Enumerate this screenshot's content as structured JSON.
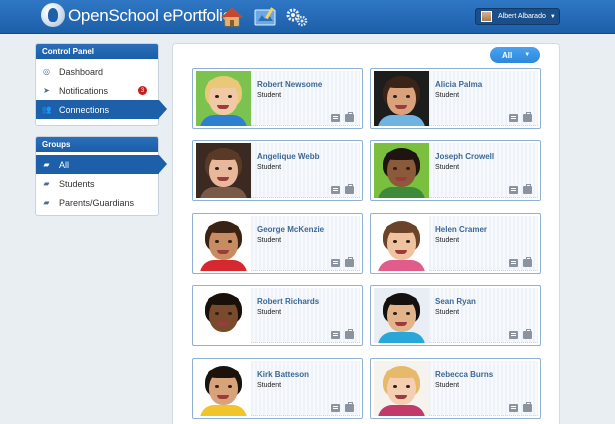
{
  "header": {
    "app_title": "OpenSchool ePortfolio",
    "icons": [
      "home-icon",
      "portfolio-icon",
      "settings-gears-icon"
    ],
    "user_name": "Albert Albarado"
  },
  "control_panel": {
    "title": "Control Panel",
    "items": [
      {
        "label": "Dashboard",
        "icon": "dashboard-icon",
        "active": false
      },
      {
        "label": "Notifications",
        "icon": "cursor-icon",
        "active": false,
        "badge": "3"
      },
      {
        "label": "Connections",
        "icon": "users-icon",
        "active": true
      }
    ]
  },
  "groups": {
    "title": "Groups",
    "items": [
      {
        "label": "All",
        "icon": "folder-icon",
        "active": true
      },
      {
        "label": "Students",
        "icon": "folder-icon",
        "active": false
      },
      {
        "label": "Parents/Guardians",
        "icon": "folder-icon",
        "active": false
      }
    ]
  },
  "filter": {
    "label": "All"
  },
  "connections": [
    {
      "name": "Robert Newsome",
      "role": "Student",
      "bg": "#7cc24f",
      "hair": "#e9c878",
      "skin": "#f2c9a6",
      "shirt": "#2f7fd1"
    },
    {
      "name": "Alicia Palma",
      "role": "Student",
      "bg": "#1d1d1d",
      "hair": "#3a2418",
      "skin": "#d9a27c",
      "shirt": "#6fb3e3"
    },
    {
      "name": "Angelique Webb",
      "role": "Student",
      "bg": "#3b2a22",
      "hair": "#5a3a26",
      "skin": "#e9b89b",
      "shirt": "#7a5a47"
    },
    {
      "name": "Joseph Crowell",
      "role": "Student",
      "bg": "#7bbf3f",
      "hair": "#1f140f",
      "skin": "#8a5a3a",
      "shirt": "#3c8a3a"
    },
    {
      "name": "George McKenzie",
      "role": "Student",
      "bg": "#ffffff",
      "hair": "#3a2214",
      "skin": "#c88c62",
      "shirt": "#d6282f"
    },
    {
      "name": "Helen Cramer",
      "role": "Student",
      "bg": "#ffffff",
      "hair": "#6b4329",
      "skin": "#f0c3a0",
      "shirt": "#e05c8b"
    },
    {
      "name": "Robert Richards",
      "role": "Student",
      "bg": "#ffffff",
      "hair": "#1a100b",
      "skin": "#7a4a2c",
      "shirt": "#ffffff"
    },
    {
      "name": "Sean Ryan",
      "role": "Student",
      "bg": "#e8eef4",
      "hair": "#141010",
      "skin": "#e3b48a",
      "shirt": "#2aa7d9"
    },
    {
      "name": "Kirk Batteson",
      "role": "Student",
      "bg": "#ffffff",
      "hair": "#1b120c",
      "skin": "#d8a37a",
      "shirt": "#f2c42b"
    },
    {
      "name": "Rebecca Burns",
      "role": "Student",
      "bg": "#f6f2ee",
      "hair": "#e7b96a",
      "skin": "#f5cfb2",
      "shirt": "#c23a6a"
    }
  ],
  "colors": {
    "brand": "#1d5fa9",
    "card_border": "#8fb1d6",
    "name_text": "#3c6896",
    "badge": "#c21f1f"
  }
}
